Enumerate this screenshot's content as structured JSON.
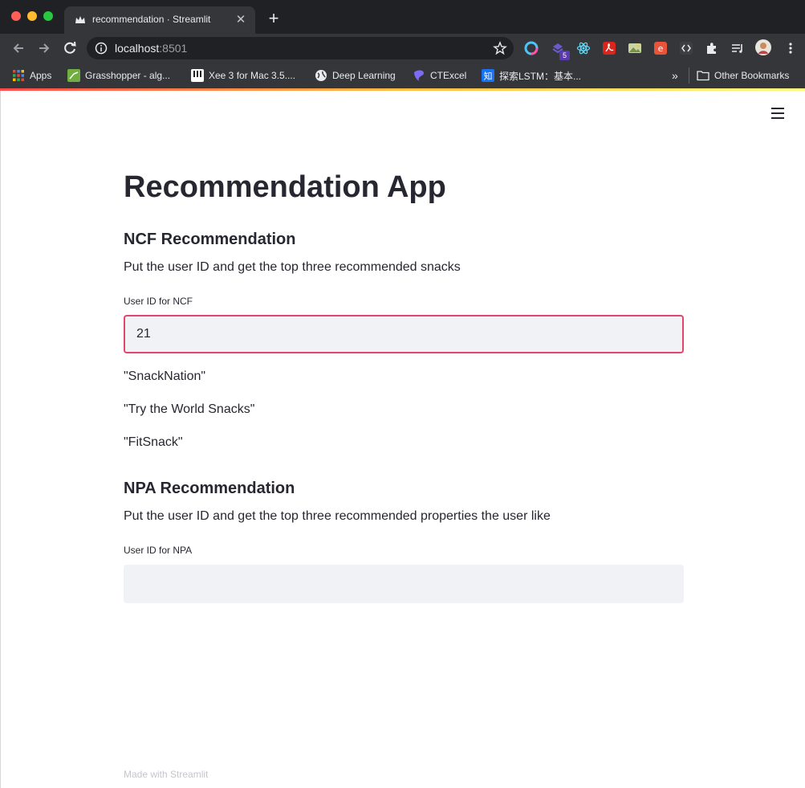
{
  "browser": {
    "tab_title": "recommendation · Streamlit",
    "url_host": "localhost",
    "url_port": ":8501",
    "extension_badge": "5",
    "bookmarks": {
      "apps": "Apps",
      "grasshopper": "Grasshopper - alg...",
      "xee": "Xee 3 for Mac 3.5....",
      "deep_learning": "Deep Learning",
      "ctexcel": "CTExcel",
      "zhihu": "探索LSTM：基本...",
      "overflow": "»",
      "other": "Other Bookmarks"
    },
    "colors": {
      "tab_strip": "#202124",
      "toolbar": "#35363a",
      "streamlit_accent": "#ff4b4b",
      "focus_border": "#e1466b"
    }
  },
  "app": {
    "title": "Recommendation App",
    "ncf": {
      "heading": "NCF Recommendation",
      "description": "Put the user ID and get the top three recommended snacks",
      "input_label": "User ID for NCF",
      "input_value": "21",
      "results": [
        "\"SnackNation\"",
        "\"Try the World Snacks\"",
        "\"FitSnack\""
      ]
    },
    "npa": {
      "heading": "NPA Recommendation",
      "description": "Put the user ID and get the top three recommended properties the user like",
      "input_label": "User ID for NPA",
      "input_value": ""
    },
    "footer": "Made with Streamlit"
  }
}
